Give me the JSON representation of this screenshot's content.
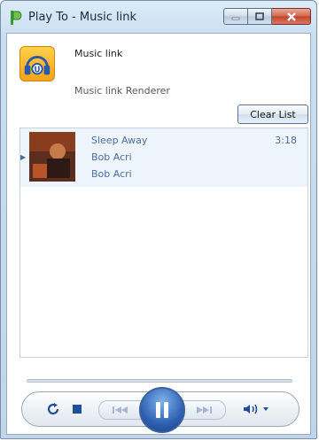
{
  "window": {
    "title": "Play To - Music link"
  },
  "device": {
    "name": "Music link",
    "description": "Music link Renderer",
    "icon": "music-link-headphones-icon"
  },
  "toolbar": {
    "clear_label": "Clear List"
  },
  "playlist": {
    "items": [
      {
        "title": "Sleep Away",
        "artist": "Bob Acri",
        "album": "Bob Acri",
        "duration": "3:18",
        "now_playing": true
      }
    ]
  },
  "controls": {
    "repeat": "repeat-icon",
    "stop": "stop-icon",
    "previous": "previous-icon",
    "play_state": "pause-icon",
    "next": "next-icon",
    "volume": "volume-icon"
  },
  "colors": {
    "accent": "#2f62b3",
    "track_text": "#4b6da6",
    "selection": "#eef4fb",
    "app_icon": "#f5a21b"
  }
}
